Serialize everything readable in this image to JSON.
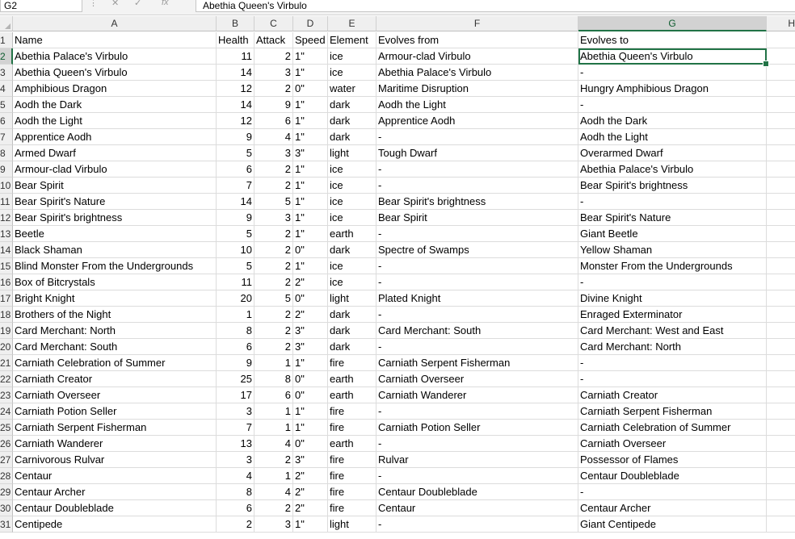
{
  "formula_bar": {
    "name_box": "G2",
    "cancel_icon": "✕",
    "enter_icon": "✓",
    "fx_label": "fx",
    "formula": "Abethia Queen's Virbulo"
  },
  "columns": [
    "A",
    "B",
    "C",
    "D",
    "E",
    "F",
    "G",
    "H"
  ],
  "selected_column": "G",
  "active_cell": "G2",
  "accent_color": "#217346",
  "rows": [
    {
      "n": "1",
      "a": "Name",
      "b": "Health",
      "c": "Attack",
      "d": "Speed",
      "e": "Element",
      "f": "Evolves from",
      "g": "Evolves to"
    },
    {
      "n": "2",
      "a": "Abethia Palace's Virbulo",
      "b": "11",
      "c": "2",
      "d": "1\"",
      "e": "ice",
      "f": "Armour-clad Virbulo",
      "g": "Abethia Queen's Virbulo"
    },
    {
      "n": "3",
      "a": "Abethia Queen's Virbulo",
      "b": "14",
      "c": "3",
      "d": "1\"",
      "e": "ice",
      "f": "Abethia Palace's Virbulo",
      "g": "-"
    },
    {
      "n": "4",
      "a": "Amphibious Dragon",
      "b": "12",
      "c": "2",
      "d": "0\"",
      "e": "water",
      "f": "Maritime Disruption",
      "g": "Hungry Amphibious Dragon"
    },
    {
      "n": "5",
      "a": "Aodh the Dark",
      "b": "14",
      "c": "9",
      "d": "1\"",
      "e": "dark",
      "f": "Aodh the Light",
      "g": "-"
    },
    {
      "n": "6",
      "a": "Aodh the Light",
      "b": "12",
      "c": "6",
      "d": "1\"",
      "e": "dark",
      "f": "Apprentice Aodh",
      "g": "Aodh the Dark"
    },
    {
      "n": "7",
      "a": "Apprentice Aodh",
      "b": "9",
      "c": "4",
      "d": "1\"",
      "e": "dark",
      "f": "-",
      "g": "Aodh the Light"
    },
    {
      "n": "8",
      "a": "Armed Dwarf",
      "b": "5",
      "c": "3",
      "d": "3\"",
      "e": "light",
      "f": "Tough Dwarf",
      "g": "Overarmed Dwarf"
    },
    {
      "n": "9",
      "a": "Armour-clad Virbulo",
      "b": "6",
      "c": "2",
      "d": "1\"",
      "e": "ice",
      "f": "-",
      "g": "Abethia Palace's Virbulo"
    },
    {
      "n": "10",
      "a": "Bear Spirit",
      "b": "7",
      "c": "2",
      "d": "1\"",
      "e": "ice",
      "f": "-",
      "g": "Bear Spirit's brightness"
    },
    {
      "n": "11",
      "a": "Bear Spirit's Nature",
      "b": "14",
      "c": "5",
      "d": "1\"",
      "e": "ice",
      "f": "Bear Spirit's brightness",
      "g": "-"
    },
    {
      "n": "12",
      "a": "Bear Spirit's brightness",
      "b": "9",
      "c": "3",
      "d": "1\"",
      "e": "ice",
      "f": "Bear Spirit",
      "g": "Bear Spirit's Nature"
    },
    {
      "n": "13",
      "a": "Beetle",
      "b": "5",
      "c": "2",
      "d": "1\"",
      "e": "earth",
      "f": "-",
      "g": "Giant Beetle"
    },
    {
      "n": "14",
      "a": "Black Shaman",
      "b": "10",
      "c": "2",
      "d": "0\"",
      "e": "dark",
      "f": "Spectre of Swamps",
      "g": "Yellow Shaman"
    },
    {
      "n": "15",
      "a": "Blind Monster From the Undergrounds",
      "b": "5",
      "c": "2",
      "d": "1\"",
      "e": "ice",
      "f": "-",
      "g": "Monster From the Undergrounds"
    },
    {
      "n": "16",
      "a": "Box of Bitcrystals",
      "b": "11",
      "c": "2",
      "d": "2\"",
      "e": "ice",
      "f": "-",
      "g": "-"
    },
    {
      "n": "17",
      "a": "Bright Knight",
      "b": "20",
      "c": "5",
      "d": "0\"",
      "e": "light",
      "f": "Plated Knight",
      "g": "Divine Knight"
    },
    {
      "n": "18",
      "a": "Brothers of the Night",
      "b": "1",
      "c": "2",
      "d": "2\"",
      "e": "dark",
      "f": "-",
      "g": "Enraged Exterminator"
    },
    {
      "n": "19",
      "a": "Card Merchant: North",
      "b": "8",
      "c": "2",
      "d": "3\"",
      "e": "dark",
      "f": "Card Merchant: South",
      "g": "Card Merchant: West and East"
    },
    {
      "n": "20",
      "a": "Card Merchant: South",
      "b": "6",
      "c": "2",
      "d": "3\"",
      "e": "dark",
      "f": "-",
      "g": "Card Merchant: North"
    },
    {
      "n": "21",
      "a": "Carniath Celebration of Summer",
      "b": "9",
      "c": "1",
      "d": "1\"",
      "e": "fire",
      "f": "Carniath Serpent Fisherman",
      "g": "-"
    },
    {
      "n": "22",
      "a": "Carniath Creator",
      "b": "25",
      "c": "8",
      "d": "0\"",
      "e": "earth",
      "f": "Carniath Overseer",
      "g": "-"
    },
    {
      "n": "23",
      "a": "Carniath Overseer",
      "b": "17",
      "c": "6",
      "d": "0\"",
      "e": "earth",
      "f": "Carniath Wanderer",
      "g": "Carniath Creator"
    },
    {
      "n": "24",
      "a": "Carniath Potion Seller",
      "b": "3",
      "c": "1",
      "d": "1\"",
      "e": "fire",
      "f": "-",
      "g": "Carniath Serpent Fisherman"
    },
    {
      "n": "25",
      "a": "Carniath Serpent Fisherman",
      "b": "7",
      "c": "1",
      "d": "1\"",
      "e": "fire",
      "f": "Carniath Potion Seller",
      "g": "Carniath Celebration of Summer"
    },
    {
      "n": "26",
      "a": "Carniath Wanderer",
      "b": "13",
      "c": "4",
      "d": "0\"",
      "e": "earth",
      "f": "-",
      "g": "Carniath Overseer"
    },
    {
      "n": "27",
      "a": "Carnivorous Rulvar",
      "b": "3",
      "c": "2",
      "d": "3\"",
      "e": "fire",
      "f": "Rulvar",
      "g": "Possessor of Flames"
    },
    {
      "n": "28",
      "a": "Centaur",
      "b": "4",
      "c": "1",
      "d": "2\"",
      "e": "fire",
      "f": "-",
      "g": "Centaur Doubleblade"
    },
    {
      "n": "29",
      "a": "Centaur Archer",
      "b": "8",
      "c": "4",
      "d": "2\"",
      "e": "fire",
      "f": "Centaur Doubleblade",
      "g": "-"
    },
    {
      "n": "30",
      "a": "Centaur Doubleblade",
      "b": "6",
      "c": "2",
      "d": "2\"",
      "e": "fire",
      "f": "Centaur",
      "g": "Centaur Archer"
    },
    {
      "n": "31",
      "a": "Centipede",
      "b": "2",
      "c": "3",
      "d": "1\"",
      "e": "light",
      "f": "-",
      "g": "Giant Centipede"
    }
  ]
}
